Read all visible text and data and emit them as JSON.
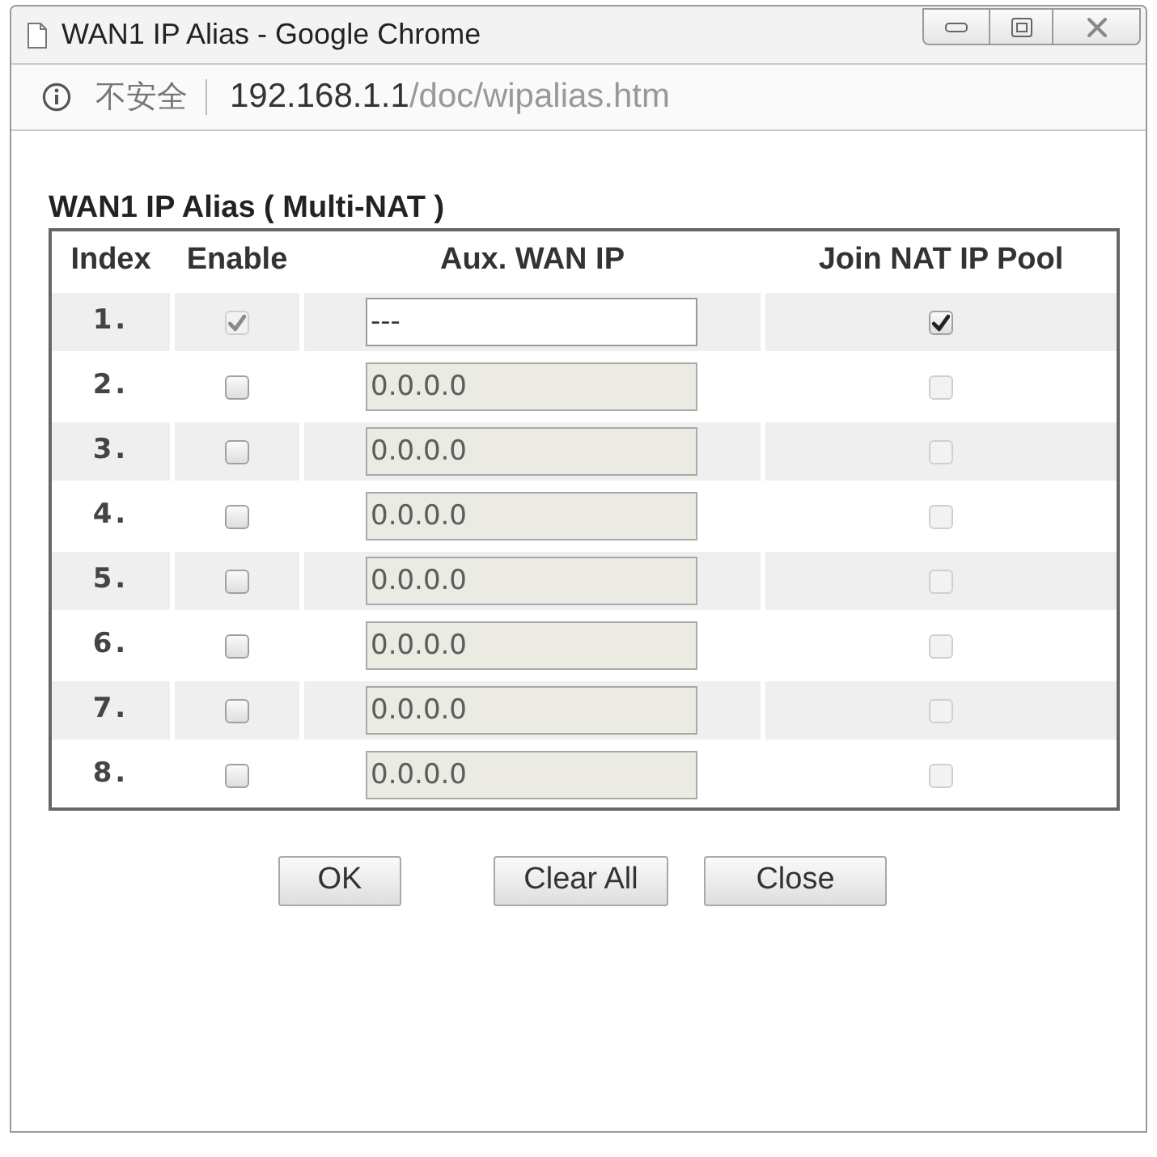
{
  "window": {
    "title": "WAN1 IP Alias - Google Chrome"
  },
  "address_bar": {
    "security_label": "不安全",
    "url_host": "192.168.1.1",
    "url_path": "/doc/wipalias.htm"
  },
  "section": {
    "title": "WAN1 IP Alias ( Multi-NAT )"
  },
  "table": {
    "columns": [
      "Index",
      "Enable",
      "Aux. WAN IP",
      "Join NAT IP Pool"
    ],
    "rows": [
      {
        "index": "1.",
        "enable": {
          "checked": true,
          "disabled": true
        },
        "aux_wan_ip": {
          "value": "---",
          "disabled": false
        },
        "join_nat_ip_pool": {
          "checked": true,
          "disabled": false
        }
      },
      {
        "index": "2.",
        "enable": {
          "checked": false,
          "disabled": false
        },
        "aux_wan_ip": {
          "value": "0.0.0.0",
          "disabled": true
        },
        "join_nat_ip_pool": {
          "checked": false,
          "disabled": true
        }
      },
      {
        "index": "3.",
        "enable": {
          "checked": false,
          "disabled": false
        },
        "aux_wan_ip": {
          "value": "0.0.0.0",
          "disabled": true
        },
        "join_nat_ip_pool": {
          "checked": false,
          "disabled": true
        }
      },
      {
        "index": "4.",
        "enable": {
          "checked": false,
          "disabled": false
        },
        "aux_wan_ip": {
          "value": "0.0.0.0",
          "disabled": true
        },
        "join_nat_ip_pool": {
          "checked": false,
          "disabled": true
        }
      },
      {
        "index": "5.",
        "enable": {
          "checked": false,
          "disabled": false
        },
        "aux_wan_ip": {
          "value": "0.0.0.0",
          "disabled": true
        },
        "join_nat_ip_pool": {
          "checked": false,
          "disabled": true
        }
      },
      {
        "index": "6.",
        "enable": {
          "checked": false,
          "disabled": false
        },
        "aux_wan_ip": {
          "value": "0.0.0.0",
          "disabled": true
        },
        "join_nat_ip_pool": {
          "checked": false,
          "disabled": true
        }
      },
      {
        "index": "7.",
        "enable": {
          "checked": false,
          "disabled": false
        },
        "aux_wan_ip": {
          "value": "0.0.0.0",
          "disabled": true
        },
        "join_nat_ip_pool": {
          "checked": false,
          "disabled": true
        }
      },
      {
        "index": "8.",
        "enable": {
          "checked": false,
          "disabled": false
        },
        "aux_wan_ip": {
          "value": "0.0.0.0",
          "disabled": true
        },
        "join_nat_ip_pool": {
          "checked": false,
          "disabled": true
        }
      }
    ]
  },
  "buttons": [
    "OK",
    "Clear All",
    "Close"
  ]
}
